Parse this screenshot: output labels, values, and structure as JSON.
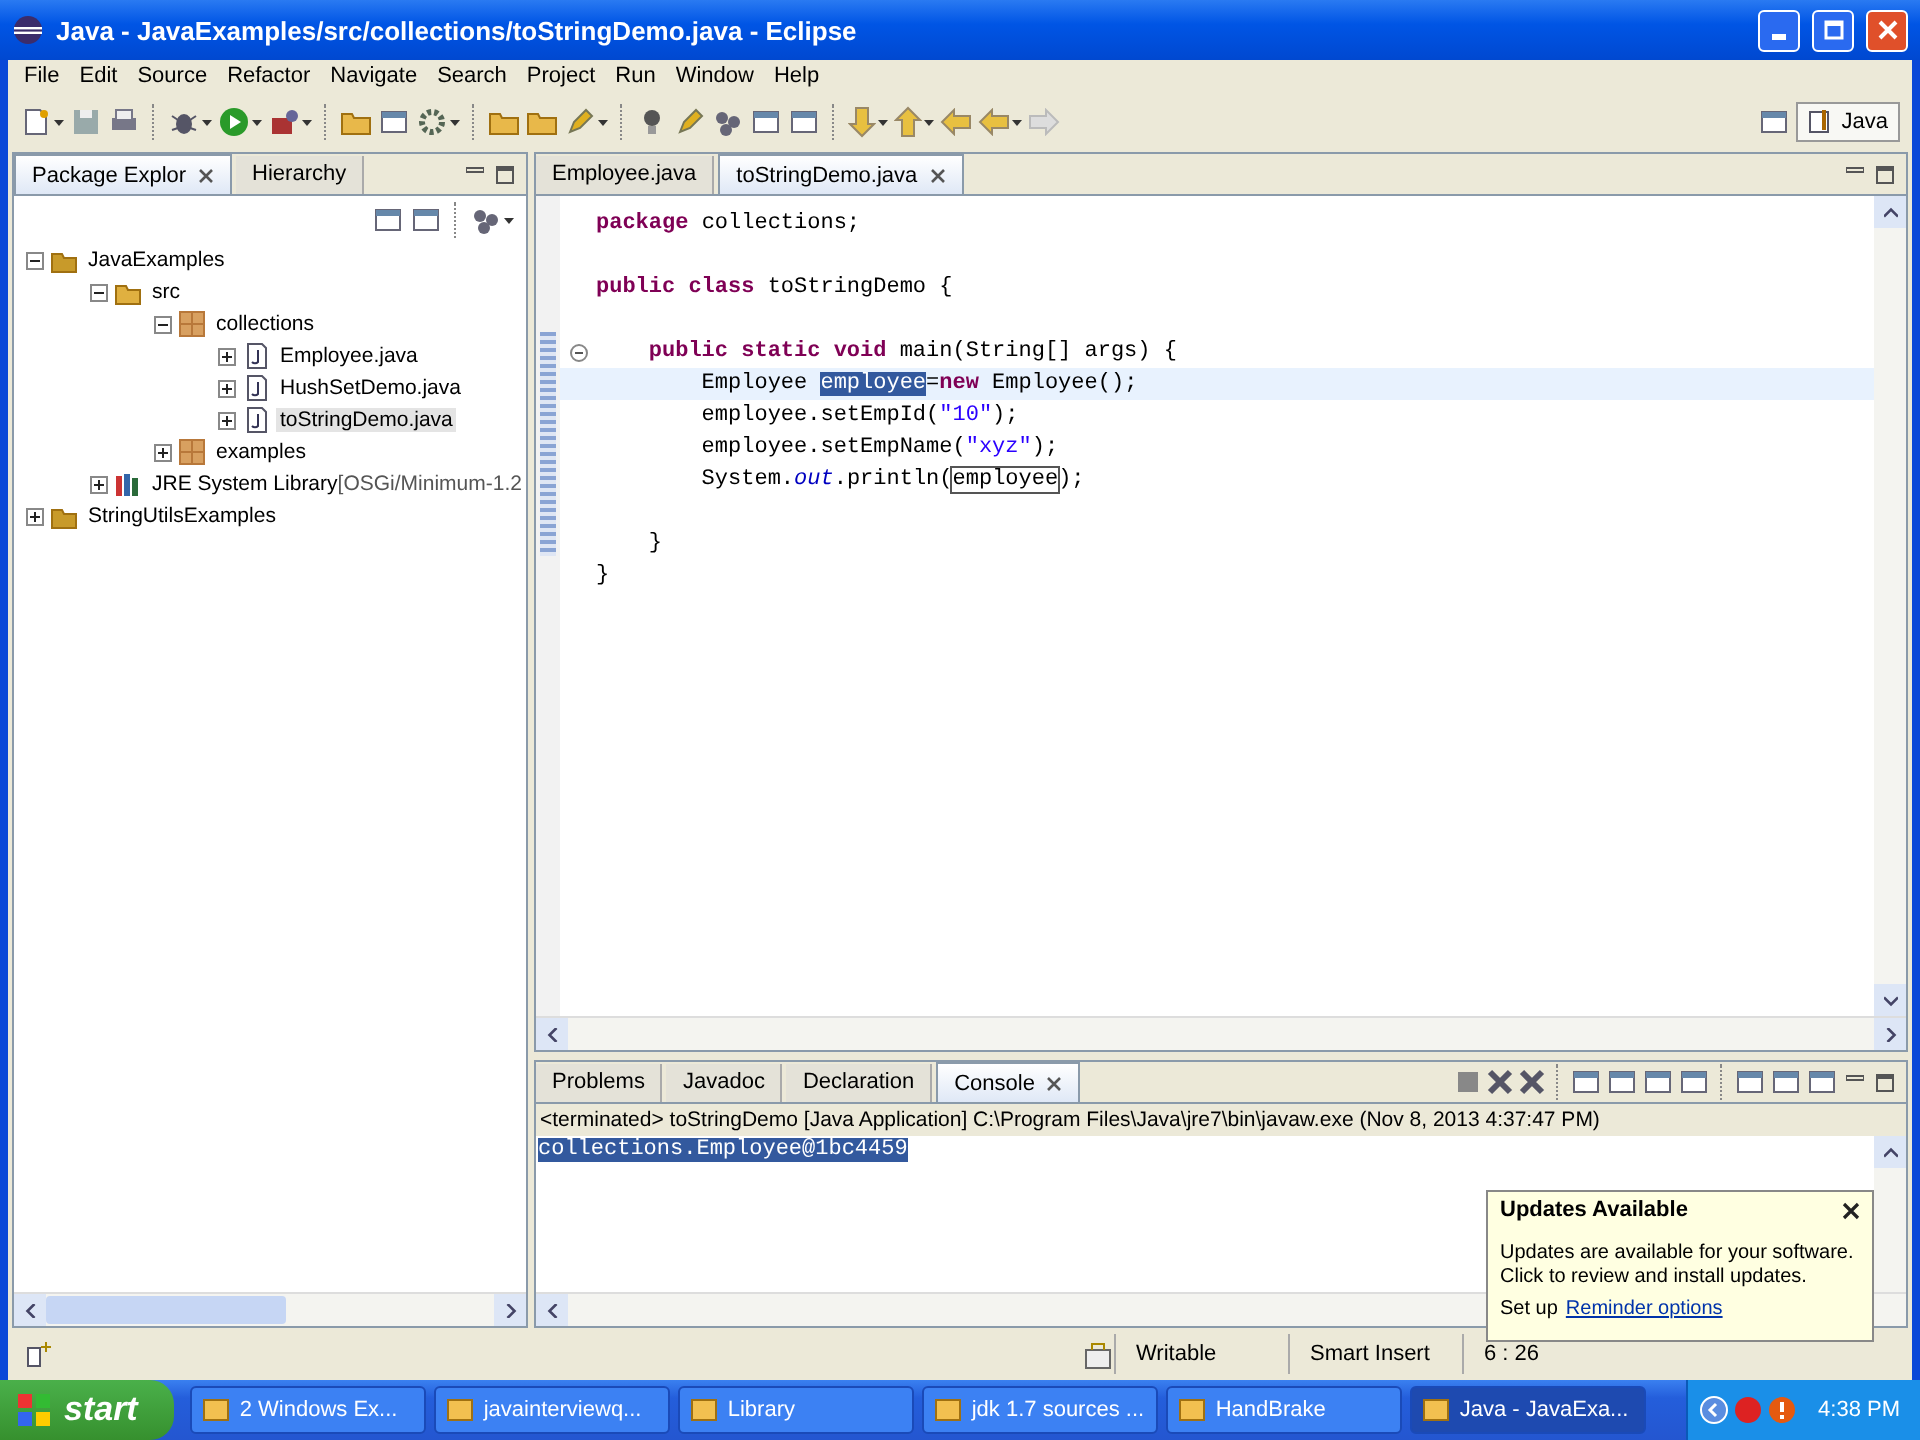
{
  "window": {
    "title": "Java - JavaExamples/src/collections/toStringDemo.java - Eclipse"
  },
  "menu": [
    "File",
    "Edit",
    "Source",
    "Refactor",
    "Navigate",
    "Search",
    "Project",
    "Run",
    "Window",
    "Help"
  ],
  "perspective": "Java",
  "left_panel": {
    "tabs": [
      {
        "label": "Package Explor",
        "selected": true
      },
      {
        "label": "Hierarchy",
        "selected": false
      }
    ],
    "tree": [
      {
        "label": "JavaExamples",
        "kind": "project",
        "expanded": true,
        "selected": false,
        "children": [
          {
            "label": "src",
            "kind": "srcfolder",
            "expanded": true,
            "selected": false,
            "children": [
              {
                "label": "collections",
                "kind": "package",
                "expanded": true,
                "selected": false,
                "children": [
                  {
                    "label": "Employee.java",
                    "kind": "file",
                    "expanded": false,
                    "selected": false
                  },
                  {
                    "label": "HushSetDemo.java",
                    "kind": "file",
                    "expanded": false,
                    "selected": false
                  },
                  {
                    "label": "toStringDemo.java",
                    "kind": "file",
                    "expanded": false,
                    "selected": true
                  }
                ]
              },
              {
                "label": "examples",
                "kind": "package",
                "expanded": false,
                "selected": false
              }
            ]
          },
          {
            "label": "JRE System Library",
            "suffix": "[OSGi/Minimum-1.2",
            "kind": "library",
            "expanded": false,
            "selected": false
          }
        ]
      },
      {
        "label": "StringUtilsExamples",
        "kind": "project",
        "expanded": false,
        "selected": false
      }
    ]
  },
  "editor": {
    "tabs": [
      {
        "label": "Employee.java",
        "selected": false
      },
      {
        "label": "toStringDemo.java",
        "selected": true
      }
    ],
    "lines": [
      {
        "current": false,
        "foldable": false,
        "segments": [
          {
            "text": "package",
            "kind": "kw"
          },
          {
            "text": " collections;",
            "kind": "plain"
          }
        ]
      },
      {
        "current": false,
        "foldable": false
      },
      {
        "current": false,
        "foldable": false,
        "segments": [
          {
            "text": "public class",
            "kind": "kw"
          },
          {
            "text": " toStringDemo {",
            "kind": "plain"
          }
        ]
      },
      {
        "current": false,
        "foldable": false
      },
      {
        "current": false,
        "foldable": true,
        "segments": [
          {
            "text": "    public static void",
            "kind": "kw"
          },
          {
            "text": " main(String[] args) {",
            "kind": "plain"
          }
        ]
      },
      {
        "current": true,
        "foldable": false,
        "segments": [
          {
            "text": "        Employee ",
            "kind": "plain"
          },
          {
            "text": "employee",
            "kind": "sel"
          },
          {
            "text": "=",
            "kind": "plain"
          },
          {
            "text": "new",
            "kind": "kw"
          },
          {
            "text": " Employee();",
            "kind": "plain"
          }
        ]
      },
      {
        "current": false,
        "foldable": false,
        "segments": [
          {
            "text": "        employee.setEmpId(",
            "kind": "plain"
          },
          {
            "text": "\"10\"",
            "kind": "str"
          },
          {
            "text": ");",
            "kind": "plain"
          }
        ]
      },
      {
        "current": false,
        "foldable": false,
        "segments": [
          {
            "text": "        employee.setEmpName(",
            "kind": "plain"
          },
          {
            "text": "\"xyz\"",
            "kind": "str"
          },
          {
            "text": ");",
            "kind": "plain"
          }
        ]
      },
      {
        "current": false,
        "foldable": false,
        "segments": [
          {
            "text": "        System.",
            "kind": "plain"
          },
          {
            "text": "out",
            "kind": "field"
          },
          {
            "text": ".println(",
            "kind": "plain"
          },
          {
            "text": "employee",
            "kind": "box"
          },
          {
            "text": ");",
            "kind": "plain"
          }
        ]
      },
      {
        "current": false,
        "foldable": false
      },
      {
        "current": false,
        "foldable": false,
        "segments": [
          {
            "text": "    }",
            "kind": "plain"
          }
        ]
      },
      {
        "current": false,
        "foldable": false,
        "segments": [
          {
            "text": "}",
            "kind": "plain"
          }
        ]
      }
    ]
  },
  "console": {
    "tabs": [
      {
        "label": "Problems",
        "selected": false
      },
      {
        "label": "Javadoc",
        "selected": false
      },
      {
        "label": "Declaration",
        "selected": false
      },
      {
        "label": "Console",
        "selected": true
      }
    ],
    "header": "<terminated> toStringDemo [Java Application] C:\\Program Files\\Java\\jre7\\bin\\javaw.exe (Nov 8, 2013 4:37:47 PM)",
    "output": "collections.Employee@1bc4459"
  },
  "status_bar": [
    "Writable",
    "Smart Insert",
    "6 : 26"
  ],
  "notification": {
    "title": "Updates Available",
    "text": "Updates are available for your software. Click to review and install updates.",
    "prefix": "Set up",
    "link": "Reminder options"
  },
  "taskbar": {
    "start": "start",
    "items": [
      {
        "label": "2 Windows Ex...",
        "selected": false
      },
      {
        "label": "javainterviewq...",
        "selected": false
      },
      {
        "label": "Library",
        "selected": false
      },
      {
        "label": "jdk 1.7 sources ...",
        "selected": false
      },
      {
        "label": "HandBrake",
        "selected": false
      },
      {
        "label": "Java - JavaExa...",
        "selected": true
      }
    ],
    "clock": "4:38 PM"
  }
}
